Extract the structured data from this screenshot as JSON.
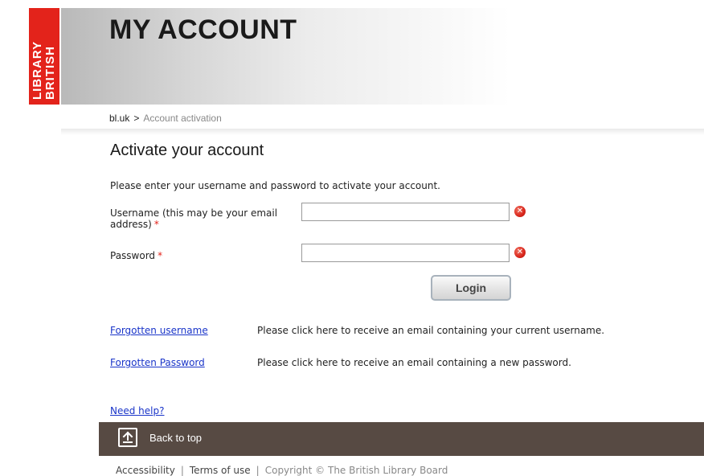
{
  "header": {
    "logo_line1": "LIBRARY",
    "logo_line2": "BRITISH",
    "title": "MY ACCOUNT"
  },
  "breadcrumb": {
    "root": "bl.uk",
    "separator": ">",
    "current": "Account activation"
  },
  "form": {
    "heading": "Activate your account",
    "intro": "Please enter your username and password to activate your account.",
    "username_label": "Username (this may be your email address)",
    "password_label": "Password",
    "required_marker": "*",
    "username_value": "",
    "password_value": "",
    "login_label": "Login"
  },
  "help_links": [
    {
      "label": "Forgotten username",
      "description": "Please click here to receive an email containing your current username."
    },
    {
      "label": "Forgotten Password",
      "description": "Please click here to receive an email containing a new password."
    }
  ],
  "need_help": "Need help?",
  "footer": {
    "back_to_top": "Back to top",
    "accessibility": "Accessibility",
    "terms": "Terms of use",
    "copyright": "Copyright © The British Library Board",
    "separator": "|"
  },
  "colors": {
    "brand_red": "#e3231b",
    "link_blue": "#1a35c9",
    "footer_brown": "#574a43"
  }
}
